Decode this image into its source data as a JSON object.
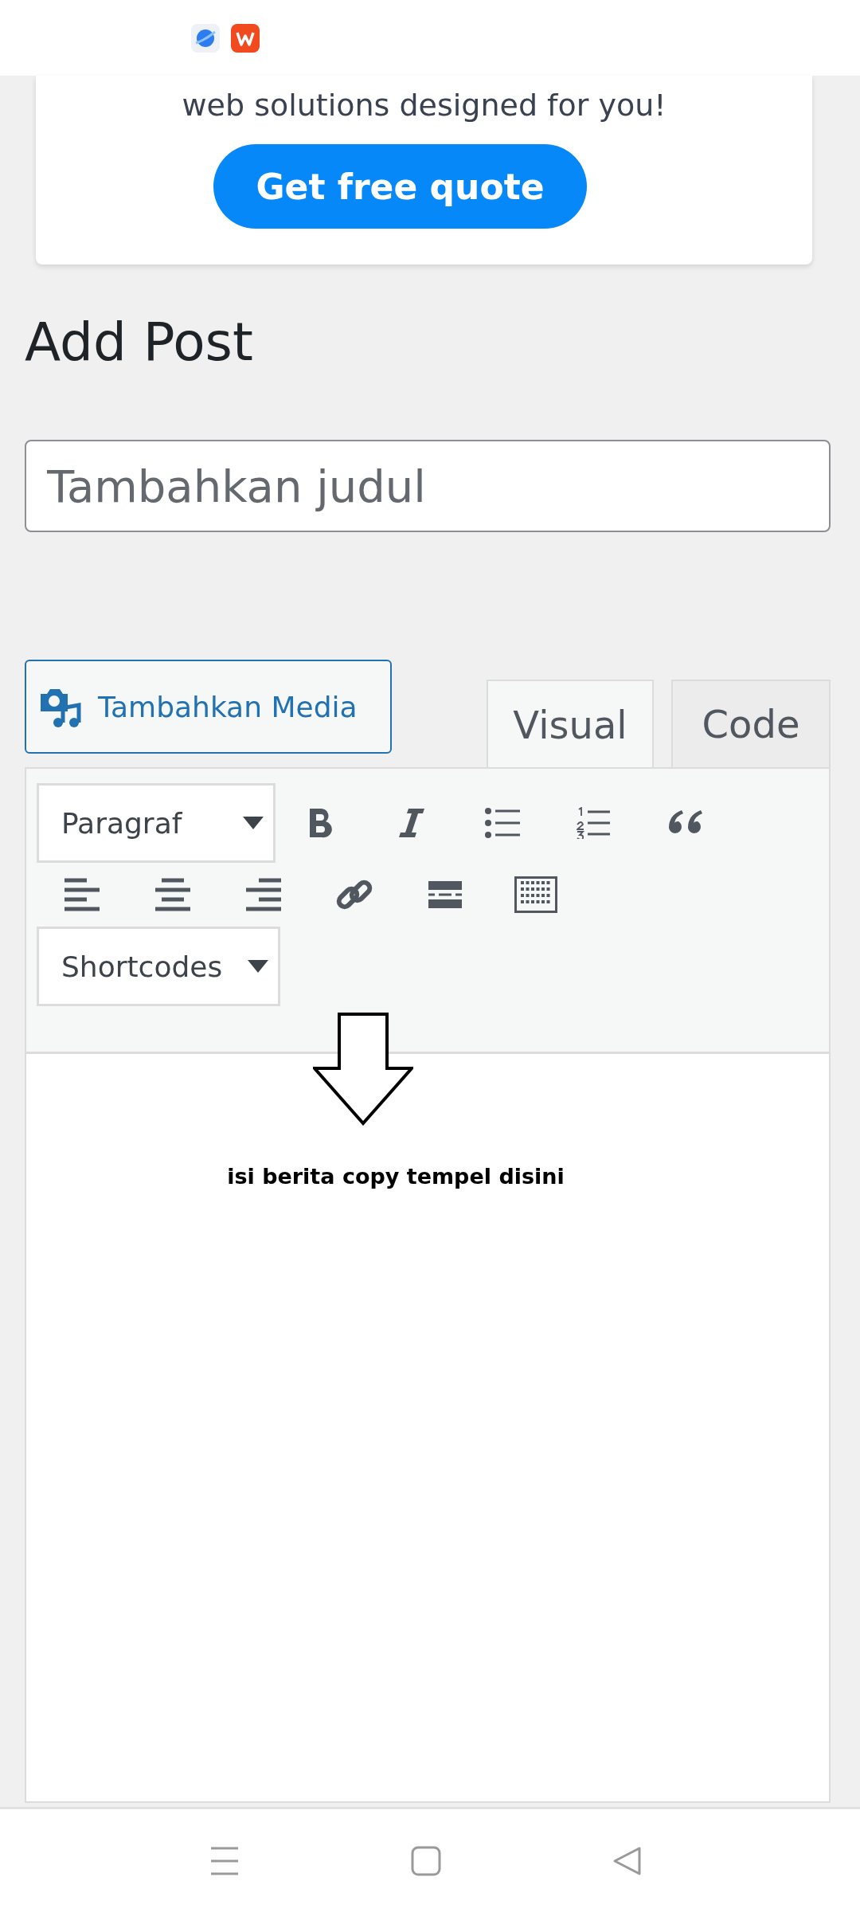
{
  "promo": {
    "text": "web solutions designed for you!",
    "button": "Get free quote"
  },
  "heading": "Add Post",
  "title_field": {
    "placeholder": "Tambahkan judul"
  },
  "media_button": "Tambahkan Media",
  "tabs": [
    {
      "label": "Visual",
      "selected": true
    },
    {
      "label": "Code",
      "selected": false
    }
  ],
  "format_select": "Paragraf",
  "shortcodes_select": "Shortcodes",
  "editor_note": "isi berita copy tempel disini"
}
